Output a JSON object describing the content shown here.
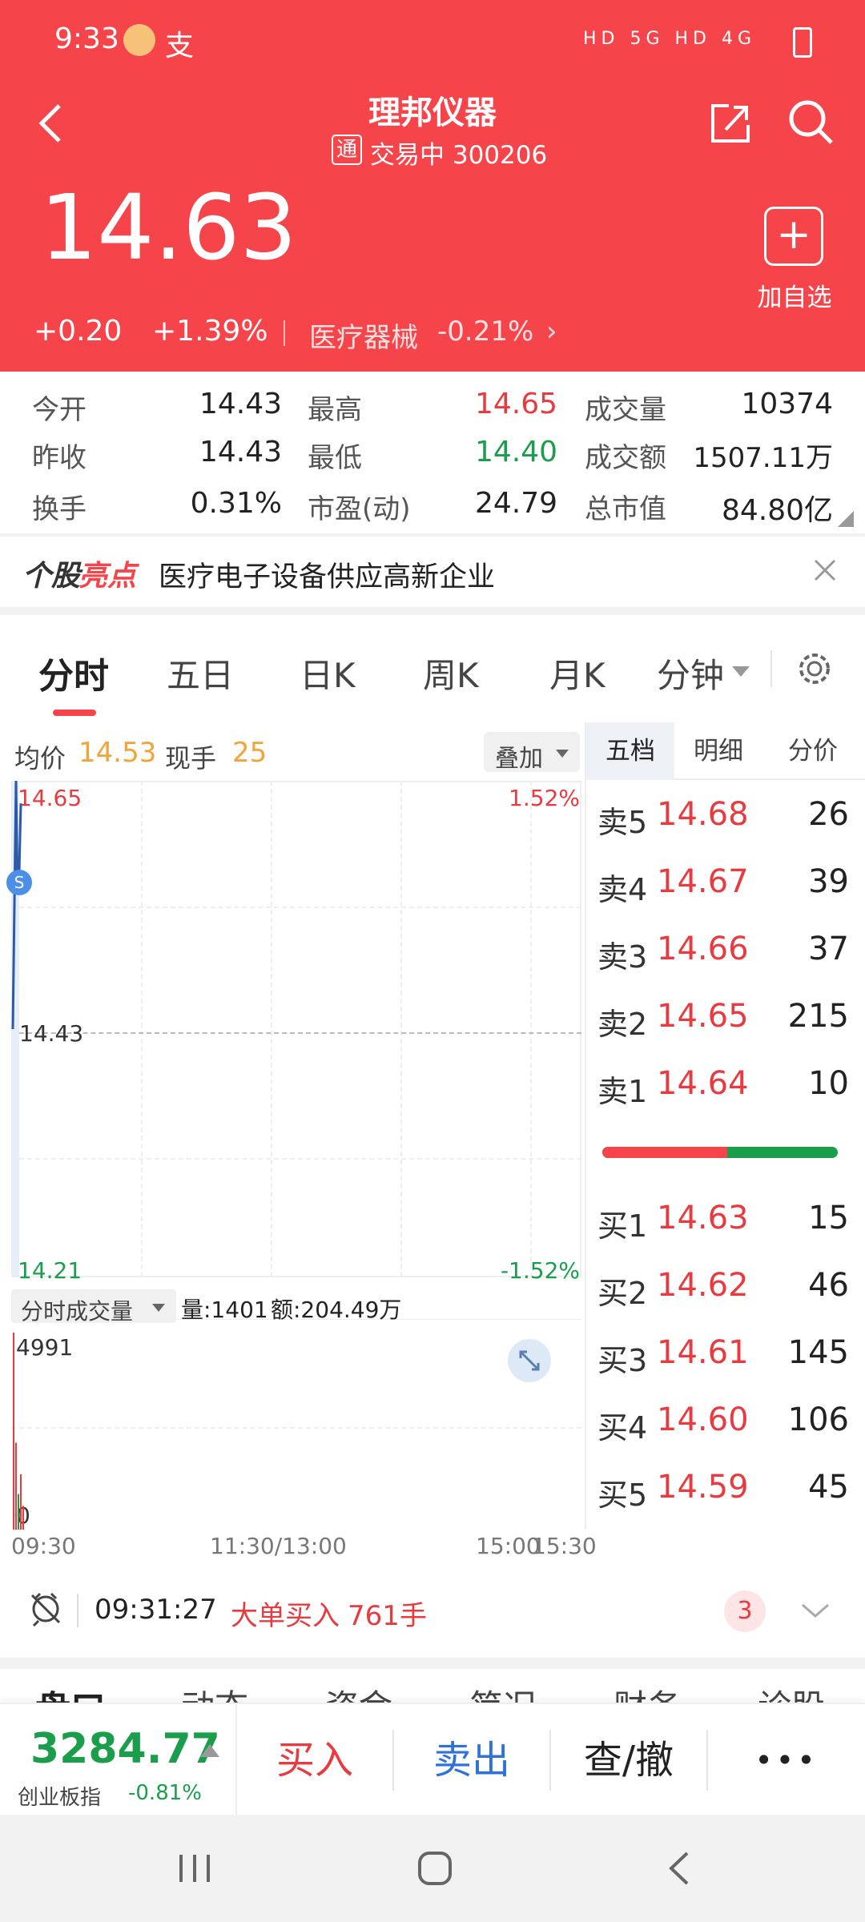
{
  "status": {
    "time": "9:33",
    "zhi": "支",
    "net": "HD 5G HD 4G"
  },
  "header": {
    "title": "理邦仪器",
    "tong": "通",
    "trading": "交易中 300206",
    "price": "14.63",
    "change": "+0.20",
    "change_pct": "+1.39%",
    "sector": "医疗器械",
    "sector_pct": "-0.21%",
    "add_fav": "加自选",
    "color": "#f6454a"
  },
  "stats": {
    "today_open_l": "今开",
    "today_open": "14.43",
    "high_l": "最高",
    "high": "14.65",
    "volume_l": "成交量",
    "volume": "10374",
    "prev_close_l": "昨收",
    "prev_close": "14.43",
    "low_l": "最低",
    "low": "14.40",
    "amount_l": "成交额",
    "amount": "1507.11万",
    "turnover_l": "换手",
    "turnover": "0.31%",
    "pe_l": "市盈(动)",
    "pe": "24.79",
    "mcap_l": "总市值",
    "mcap": "84.80亿"
  },
  "highlight": {
    "label_a": "个股",
    "label_b": "亮点",
    "text": "医疗电子设备供应高新企业"
  },
  "tabs": [
    "分时",
    "五日",
    "日K",
    "周K",
    "月K",
    "分钟"
  ],
  "chart_info": {
    "avg_l": "均价",
    "avg": "14.53",
    "cur_l": "现手",
    "cur": "25",
    "overlay": "叠加"
  },
  "ob_tabs": [
    "五档",
    "明细",
    "分价"
  ],
  "chart_data": {
    "type": "line",
    "price_ticks": {
      "top": "14.65",
      "mid": "14.43",
      "bottom": "14.21"
    },
    "pct_ticks": {
      "top": "1.52%",
      "bottom": "-1.52%"
    },
    "ylim": [
      14.21,
      14.65
    ],
    "x_ticks": [
      "09:30",
      "11:30/13:00",
      "15:00",
      "15:30"
    ],
    "series": [
      {
        "values": [
          14.43,
          14.65,
          14.55,
          14.57,
          14.63
        ]
      }
    ],
    "volume": {
      "label": "分时成交量",
      "vol_l": "量:1401",
      "amt_l": "额:204.49万",
      "max": "4991",
      "min": "0",
      "values": [
        4991,
        2200,
        900,
        1401,
        600
      ]
    }
  },
  "orderbook": {
    "sells": [
      {
        "l": "卖5",
        "p": "14.68",
        "q": "26"
      },
      {
        "l": "卖4",
        "p": "14.67",
        "q": "39"
      },
      {
        "l": "卖3",
        "p": "14.66",
        "q": "37"
      },
      {
        "l": "卖2",
        "p": "14.65",
        "q": "215"
      },
      {
        "l": "卖1",
        "p": "14.64",
        "q": "10"
      }
    ],
    "buys": [
      {
        "l": "买1",
        "p": "14.63",
        "q": "15"
      },
      {
        "l": "买2",
        "p": "14.62",
        "q": "46"
      },
      {
        "l": "买3",
        "p": "14.61",
        "q": "145"
      },
      {
        "l": "买4",
        "p": "14.60",
        "q": "106"
      },
      {
        "l": "买5",
        "p": "14.59",
        "q": "45"
      }
    ],
    "buy_ratio": 0.53
  },
  "alert": {
    "time": "09:31:27",
    "text": "大单买入",
    "qty": "761手",
    "badge": "3"
  },
  "bottom_tabs": [
    "盘口",
    "动态",
    "资金",
    "简况",
    "财务",
    "诊股"
  ],
  "bottom": {
    "index_val": "3284.77",
    "index_name": "创业板指",
    "index_pct": "-0.81%",
    "buy": "买入",
    "sell": "卖出",
    "query": "查/撤",
    "more": "•••"
  }
}
